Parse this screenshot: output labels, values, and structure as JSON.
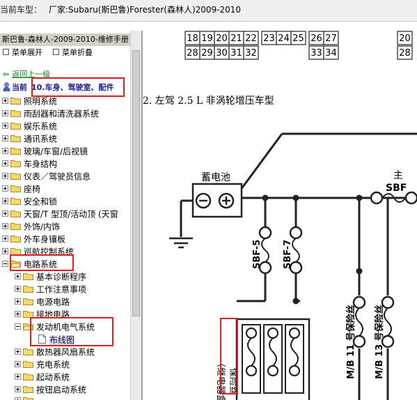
{
  "topbar": {
    "label": "当前车型：",
    "value": "厂家:Subaru(斯巴鲁)Forester(森林人)2009-2010"
  },
  "left_panel": {
    "title": "斯巴鲁-森林人-2009-2010-维修手册",
    "expand_all": "菜单展开",
    "collapse_all": "菜单折叠",
    "back_link": "返回上一级",
    "current_label": "当前",
    "current_value": "10.车身、驾驶室、配件"
  },
  "tree": {
    "items": [
      {
        "label": "照明系统"
      },
      {
        "label": "雨刮器和清洗器系统"
      },
      {
        "label": "娱乐系统"
      },
      {
        "label": "通讯系统"
      },
      {
        "label": "玻璃/车窗/后视镜"
      },
      {
        "label": "车身结构"
      },
      {
        "label": "仪表／驾驶员信息"
      },
      {
        "label": "座椅"
      },
      {
        "label": "安全和锁"
      },
      {
        "label": "天窗/T 型顶/活动顶 (天窗"
      },
      {
        "label": "外饰/内饰"
      },
      {
        "label": "外车身镶板"
      },
      {
        "label": "巡航控制系统"
      },
      {
        "label": "电路系统"
      },
      {
        "label": "基本诊断程序"
      },
      {
        "label": "工作注意事项"
      },
      {
        "label": "电源电路"
      },
      {
        "label": "接地电路"
      },
      {
        "label": "发动机电气系统"
      },
      {
        "label": "布线图"
      },
      {
        "label": "散热器风扇系统"
      },
      {
        "label": "充电系统"
      },
      {
        "label": "起动系统"
      },
      {
        "label": "按钮启动系统"
      }
    ]
  },
  "content": {
    "fuse_table": {
      "row1": [
        "18",
        "19",
        "20",
        "21",
        "22",
        "23",
        "24",
        "25",
        "26",
        "27"
      ],
      "row2": [
        "28",
        "29",
        "30",
        "31",
        "32",
        "33",
        "34"
      ],
      "right_row1": "20",
      "right_row2": "28"
    },
    "heading": "2. 左驾 2.5 L 非涡轮增压车型",
    "diagram": {
      "battery": "蓄电池",
      "main_label_1": "主",
      "main_label_2": "SBF",
      "sbf5": "SBF-5",
      "sbf7": "SBF-7",
      "fuse_box_1": "保险丝",
      "fuse_box_2": "（继电器盒）",
      "mb11": "M/B 11 号保险丝",
      "mb13": "M/B 13 号保险丝"
    }
  },
  "colors": {
    "highlight_box": "#e02020",
    "link_green": "#0a8f0a",
    "current_blue": "#1a1a99"
  }
}
